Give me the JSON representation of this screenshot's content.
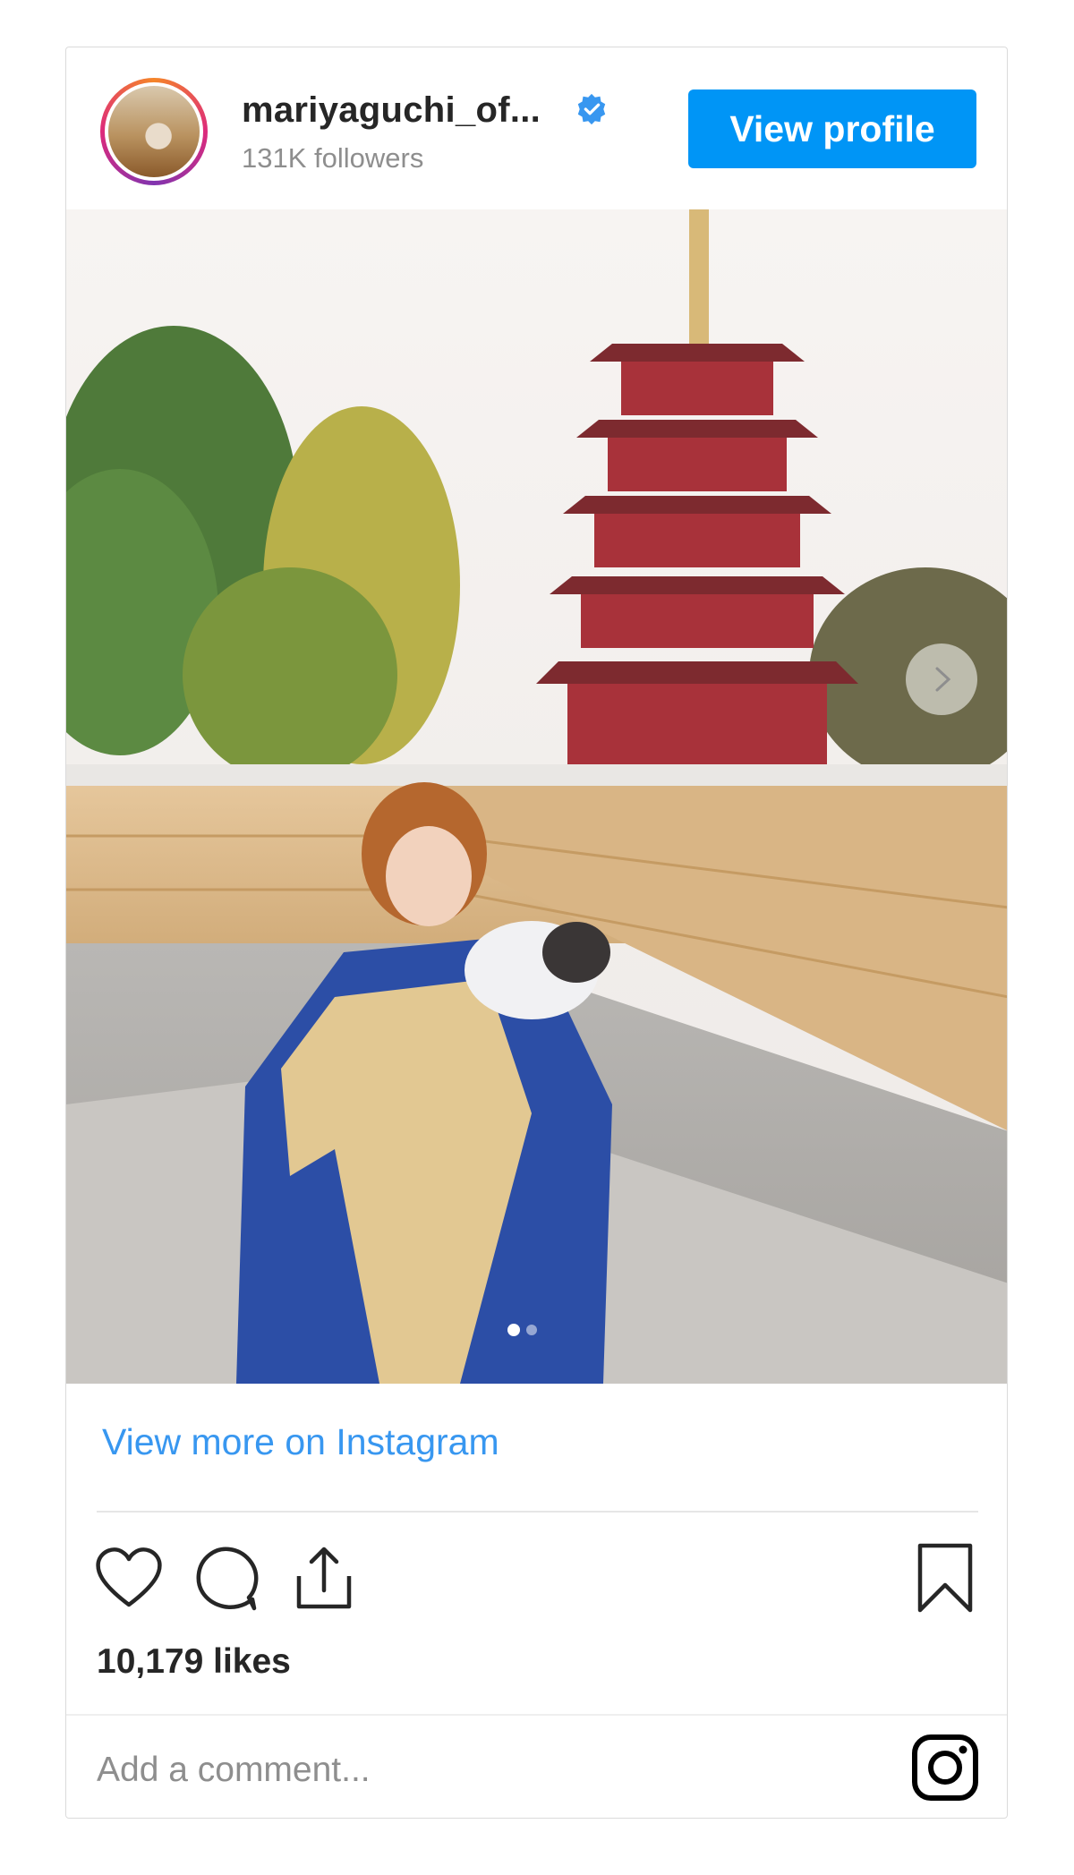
{
  "header": {
    "username": "mariyaguchi_of...",
    "followers": "131K followers",
    "view_profile_label": "View profile"
  },
  "post": {
    "photo_icon": "photo-carousel",
    "view_more_label": "View more on Instagram",
    "likes": "10,179 likes",
    "comment_placeholder": "Add a comment..."
  },
  "icons": {
    "verified": "verified-badge-icon",
    "like": "heart-icon",
    "comment": "comment-bubble-icon",
    "share": "share-icon",
    "save": "bookmark-icon",
    "instagram": "instagram-logo-icon",
    "next": "chevron-right-icon"
  },
  "colors": {
    "accent": "#0095f6",
    "link": "#3897f0",
    "text": "#262626",
    "muted": "#8e8e8e"
  }
}
